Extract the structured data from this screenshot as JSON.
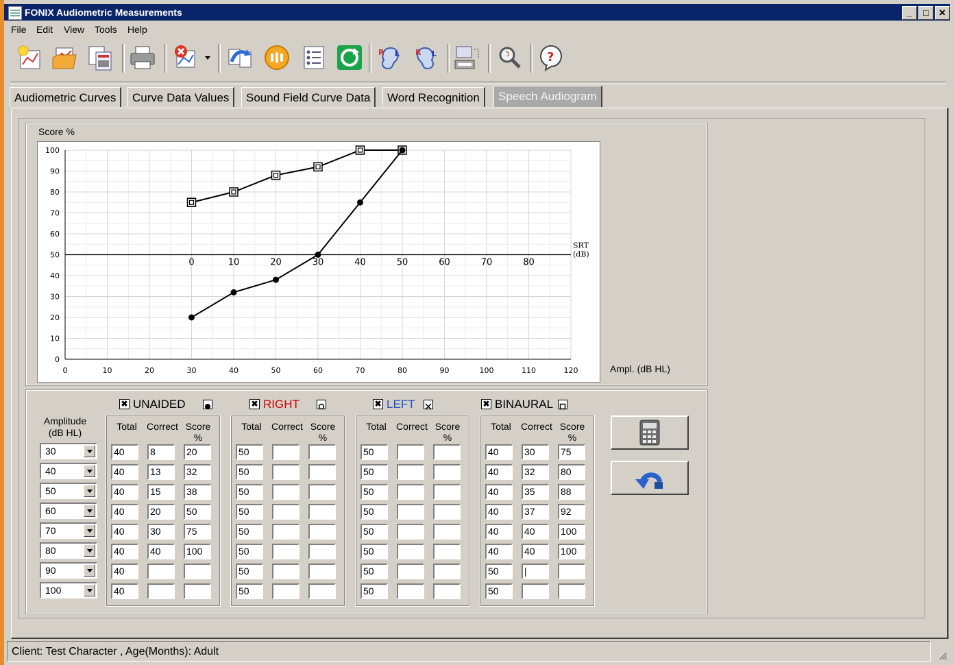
{
  "window": {
    "title": "FONIX Audiometric Measurements"
  },
  "menu": [
    "File",
    "Edit",
    "View",
    "Tools",
    "Help"
  ],
  "toolbar_icons": [
    "new-session-icon",
    "open-folder-icon",
    "save-data-icon",
    "print-icon",
    "delete-curve-icon",
    "import-export-icon",
    "audiometer-icon",
    "checklist-icon",
    "refresh-icon",
    "left-ear-icon",
    "right-ear-icon",
    "data-transfer-icon",
    "search-patient-icon",
    "help-icon"
  ],
  "tabs": [
    "Audiometric Curves",
    "Curve Data Values",
    "Sound Field Curve Data",
    "Word Recognition",
    "Speech Audiogram"
  ],
  "active_tab": "Speech Audiogram",
  "chart": {
    "score_label": "Score %",
    "ampl_label": "Ampl. (dB HL)",
    "srt_label_1": "SRT",
    "srt_label_2": "(dB)"
  },
  "chart_data": {
    "type": "line",
    "xlabel": "Ampl. (dB HL)",
    "ylabel": "Score %",
    "xlim": [
      0,
      120
    ],
    "ylim": [
      0,
      100
    ],
    "x_ticks": [
      0,
      10,
      20,
      30,
      40,
      50,
      60,
      70,
      80,
      90,
      100,
      110,
      120
    ],
    "y_ticks": [
      0,
      10,
      20,
      30,
      40,
      50,
      60,
      70,
      80,
      90,
      100
    ],
    "srt_axis": {
      "label": "SRT (dB)",
      "y": 50,
      "ticks": [
        0,
        10,
        20,
        30,
        40,
        50,
        60,
        70,
        80
      ],
      "x_offset": 30
    },
    "grid": true,
    "series": [
      {
        "marker": "open-square",
        "x": [
          30,
          40,
          50,
          60,
          70,
          80
        ],
        "y": [
          75,
          80,
          88,
          92,
          100,
          100
        ]
      },
      {
        "marker": "filled-circle",
        "x": [
          30,
          40,
          50,
          60,
          70,
          80
        ],
        "y": [
          20,
          32,
          38,
          50,
          75,
          100
        ]
      }
    ]
  },
  "table": {
    "amplitude_header_1": "Amplitude",
    "amplitude_header_2": "(dB HL)",
    "amplitudes": [
      "30",
      "40",
      "50",
      "60",
      "70",
      "80",
      "90",
      "100"
    ],
    "col_total": "Total",
    "col_correct": "Correct",
    "col_score_1": "Score",
    "col_score_2": "%",
    "ears": [
      {
        "label": "UNAIDED",
        "checked": "✖",
        "color": "#000000",
        "symbol": "filled-circle",
        "total": [
          "40",
          "40",
          "40",
          "40",
          "40",
          "40",
          "40",
          "40"
        ],
        "correct": [
          "8",
          "13",
          "15",
          "20",
          "30",
          "40",
          "",
          ""
        ],
        "score": [
          "20",
          "32",
          "38",
          "50",
          "75",
          "100",
          "",
          ""
        ]
      },
      {
        "label": "RIGHT",
        "checked": "✖",
        "color": "#cc0000",
        "symbol": "circle-in-square",
        "total": [
          "50",
          "50",
          "50",
          "50",
          "50",
          "50",
          "50",
          "50"
        ],
        "correct": [
          "",
          "",
          "",
          "",
          "",
          "",
          "",
          ""
        ],
        "score": [
          "",
          "",
          "",
          "",
          "",
          "",
          "",
          ""
        ]
      },
      {
        "label": "LEFT",
        "checked": "✖",
        "color": "#1f4fbf",
        "symbol": "x-in-square",
        "total": [
          "50",
          "50",
          "50",
          "50",
          "50",
          "50",
          "50",
          "50"
        ],
        "correct": [
          "",
          "",
          "",
          "",
          "",
          "",
          "",
          ""
        ],
        "score": [
          "",
          "",
          "",
          "",
          "",
          "",
          "",
          ""
        ]
      },
      {
        "label": "BINAURAL",
        "checked": "✖",
        "color": "#000000",
        "symbol": "square-in-square",
        "total": [
          "40",
          "40",
          "40",
          "40",
          "40",
          "40",
          "50",
          "50"
        ],
        "correct": [
          "30",
          "32",
          "35",
          "37",
          "40",
          "40",
          "|",
          ""
        ],
        "score": [
          "75",
          "80",
          "88",
          "92",
          "100",
          "100",
          "",
          ""
        ]
      }
    ]
  },
  "buttons": {
    "calculate": "calculator-icon",
    "undo": "undo-arrow-icon"
  },
  "status": {
    "text": "Client: Test Character , Age(Months): Adult"
  }
}
